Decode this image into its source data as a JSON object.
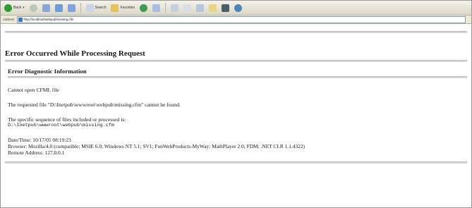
{
  "toolbar": {
    "back_label": "Back",
    "search_label": "Search",
    "favorites_label": "Favorites"
  },
  "addressbar": {
    "label": "Address",
    "url": "http://localhost/webpub/missing.cfm"
  },
  "page": {
    "title": "Error Occurred While Processing Request",
    "section_title": "Error Diagnostic Information",
    "error_heading": "Cannot open CFML file",
    "error_detail": "The requested file \"D:\\Inetpub\\wwwroot\\webpub\\missing.cfm\" cannot be found.",
    "sequence_intro": "The specific sequence of files included or processed is:",
    "sequence_path": "D:\\Inetpub\\wwwroot\\webpub\\missing.cfm",
    "date_time": "Date/Time: 10/17/05 08:19:23",
    "browser": "Browser: Mozilla/4.0 (compatible; MSIE 6.0; Windows NT 5.1; SV1; FunWebProducts-MyWay; MathPlayer 2.0; FDM; .NET CLR 1.1.4322)",
    "remote_address": "Remote Address: 127.0.0.1"
  },
  "colors": {
    "toolbar_bg": "#e6e3d6",
    "text": "#1a1a1a",
    "link_blue": "#3a72c4"
  },
  "icons": [
    "back-icon",
    "forward-icon",
    "stop-icon",
    "refresh-icon",
    "home-icon",
    "search-icon",
    "favorites-icon",
    "media-icon",
    "history-icon",
    "mail-icon",
    "print-icon",
    "edit-icon",
    "discuss-icon",
    "messenger-icon"
  ]
}
